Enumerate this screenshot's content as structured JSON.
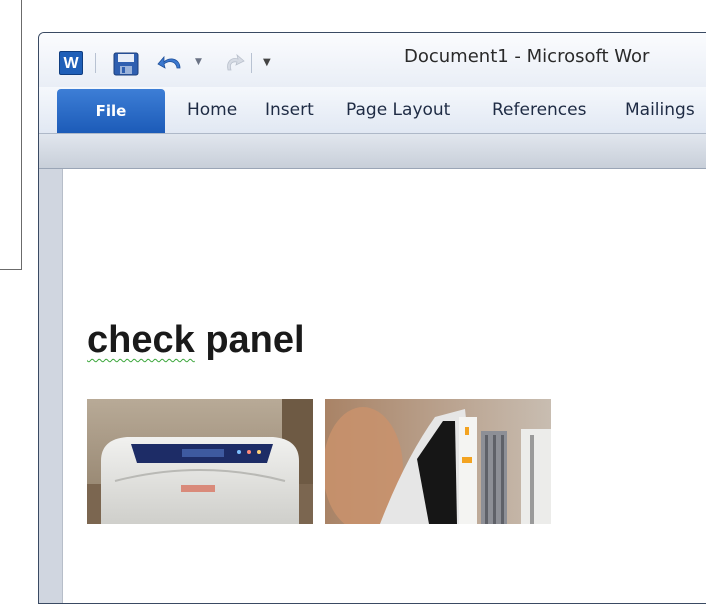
{
  "window": {
    "title": "Document1  -  Microsoft Wor"
  },
  "quick_access": {
    "app_icon": "word-app-icon",
    "app_letter": "W",
    "save_icon": "save-icon",
    "undo_icon": "undo-icon",
    "redo_icon": "redo-icon",
    "customize_icon": "customize-toolbar-icon"
  },
  "ribbon": {
    "file_tab": "File",
    "tabs": [
      "Home",
      "Insert",
      "Page Layout",
      "References",
      "Mailings"
    ]
  },
  "document": {
    "heading_word1": "check",
    "heading_word2": "panel",
    "images": [
      "printer-control-panel-photo",
      "printer-side-access-photo"
    ]
  },
  "colors": {
    "file_tab": "#1c5bb8",
    "spellcheck_underline": "#3aa63a",
    "word_blue": "#1f5fb8"
  }
}
